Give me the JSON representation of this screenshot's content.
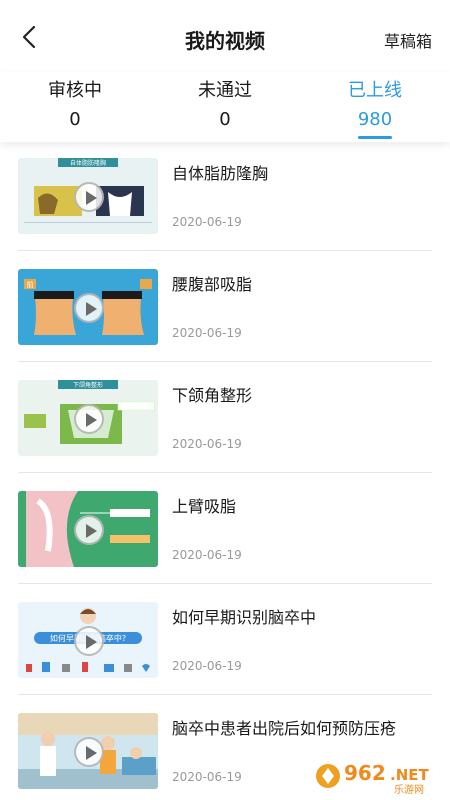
{
  "header": {
    "title": "我的视频",
    "drafts_label": "草稿箱"
  },
  "tabs": [
    {
      "label": "审核中",
      "count": "0",
      "active": false
    },
    {
      "label": "未通过",
      "count": "0",
      "active": false
    },
    {
      "label": "已上线",
      "count": "980",
      "active": true
    }
  ],
  "videos": [
    {
      "title": "自体脂肪隆胸",
      "date": "2020-06-19",
      "thumb_text": "自体脂肪隆胸"
    },
    {
      "title": "腰腹部吸脂",
      "date": "2020-06-19",
      "thumb_text": "前"
    },
    {
      "title": "下颌角整形",
      "date": "2020-06-19",
      "thumb_text": "下颌角整形"
    },
    {
      "title": "上臂吸脂",
      "date": "2020-06-19",
      "thumb_text": ""
    },
    {
      "title": "如何早期识别脑卒中",
      "date": "2020-06-19",
      "thumb_text": "如何早期识别脑卒中?"
    },
    {
      "title": "脑卒中患者出院后如何预防压疮",
      "date": "2020-06-19",
      "thumb_text": ""
    }
  ],
  "watermark": {
    "number": "962",
    "suffix": ".NET",
    "site": "乐游网"
  },
  "colors": {
    "accent": "#2c9be0",
    "divider": "#e6e6e6",
    "date_gray": "#999999"
  }
}
